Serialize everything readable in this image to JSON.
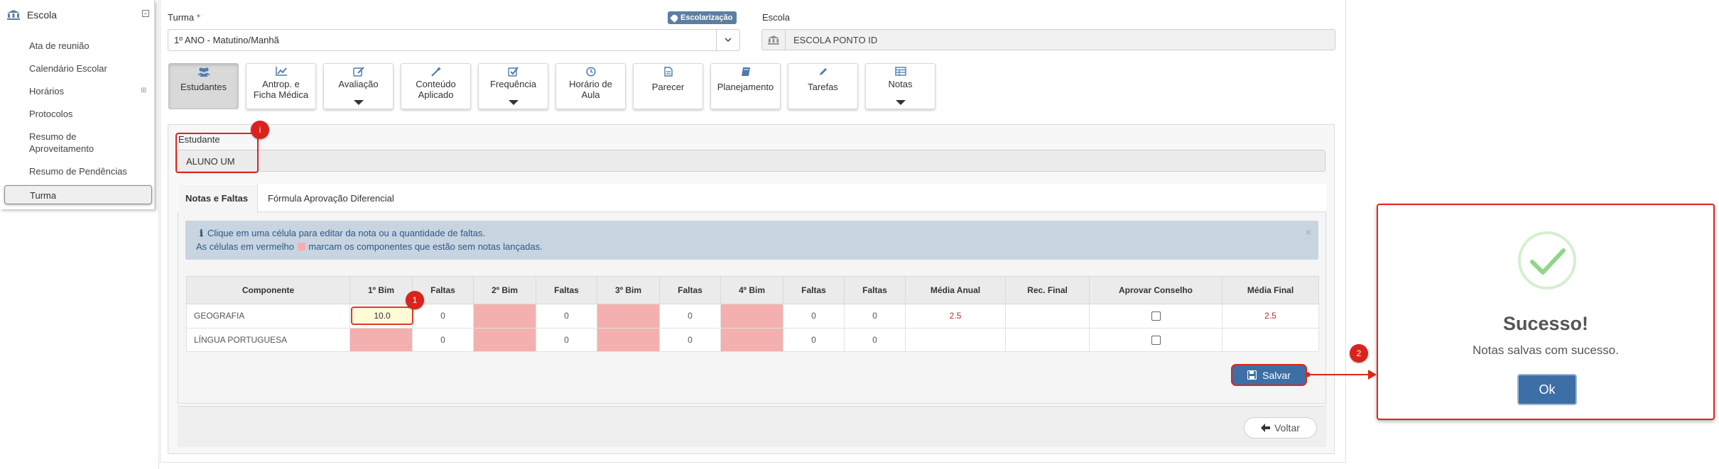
{
  "sidebar": {
    "header": "Escola",
    "items": [
      {
        "label": "Ata de reunião"
      },
      {
        "label": "Calendário Escolar"
      },
      {
        "label": "Horários"
      },
      {
        "label": "Protocolos"
      },
      {
        "label": "Resumo de"
      },
      {
        "label": "Aproveitamento"
      },
      {
        "label": "Resumo de Pendências"
      },
      {
        "label": "Turma"
      }
    ]
  },
  "form": {
    "turma_label": "Turma",
    "required_mark": "*",
    "turma_value": "1º ANO - Matutino/Manhã",
    "badge": "Escolarização",
    "escola_label": "Escola",
    "escola_value": "ESCOLA PONTO ID"
  },
  "tabs": [
    {
      "line1": "Estudantes",
      "line2": ""
    },
    {
      "line1": "Antrop. e",
      "line2": "Ficha Médica"
    },
    {
      "line1": "Avaliação",
      "line2": ""
    },
    {
      "line1": "Conteúdo",
      "line2": "Aplicado"
    },
    {
      "line1": "Frequência",
      "line2": ""
    },
    {
      "line1": "Horário de",
      "line2": "Aula"
    },
    {
      "line1": "Parecer",
      "line2": ""
    },
    {
      "line1": "Planejamento",
      "line2": ""
    },
    {
      "line1": "Tarefas",
      "line2": ""
    },
    {
      "line1": "Notas",
      "line2": ""
    }
  ],
  "student": {
    "label": "Estudante",
    "value": "ALUNO UM"
  },
  "subtabs": {
    "active": "Notas e Faltas",
    "other": "Fórmula Aprovação Diferencial"
  },
  "alert": {
    "line1": "Clique em uma célula para editar da nota ou a quantidade de faltas.",
    "line2_pre": "As células em vermelho",
    "line2_post": "marcam os componentes que estão sem notas lançadas.",
    "close": "×"
  },
  "grid": {
    "headers": [
      "Componente",
      "1º Bim",
      "Faltas",
      "2º Bim",
      "Faltas",
      "3º Bim",
      "Faltas",
      "4º Bim",
      "Faltas",
      "Faltas",
      "Média Anual",
      "Rec. Final",
      "Aprovar Conselho",
      "Média Final"
    ],
    "rows": [
      {
        "comp": "GEOGRAFIA",
        "b1": "10.0",
        "f1": "0",
        "f2": "0",
        "f3": "0",
        "f4": "0",
        "ft": "0",
        "media": "2.5",
        "final": "2.5"
      },
      {
        "comp": "LÍNGUA PORTUGUESA",
        "b1": "",
        "f1": "0",
        "f2": "0",
        "f3": "0",
        "f4": "0",
        "ft": "0",
        "media": "",
        "final": ""
      }
    ]
  },
  "buttons": {
    "save": "Salvar",
    "back": "Voltar"
  },
  "callouts": [
    "i",
    "1",
    "2"
  ],
  "modal": {
    "title": "Sucesso!",
    "message": "Notas salvas com sucesso.",
    "ok": "Ok"
  },
  "colors": {
    "primary": "#3d6fa6",
    "highlight": "#e0241b",
    "empty_cell": "#f4b0ae",
    "success": "#8fd68a"
  }
}
